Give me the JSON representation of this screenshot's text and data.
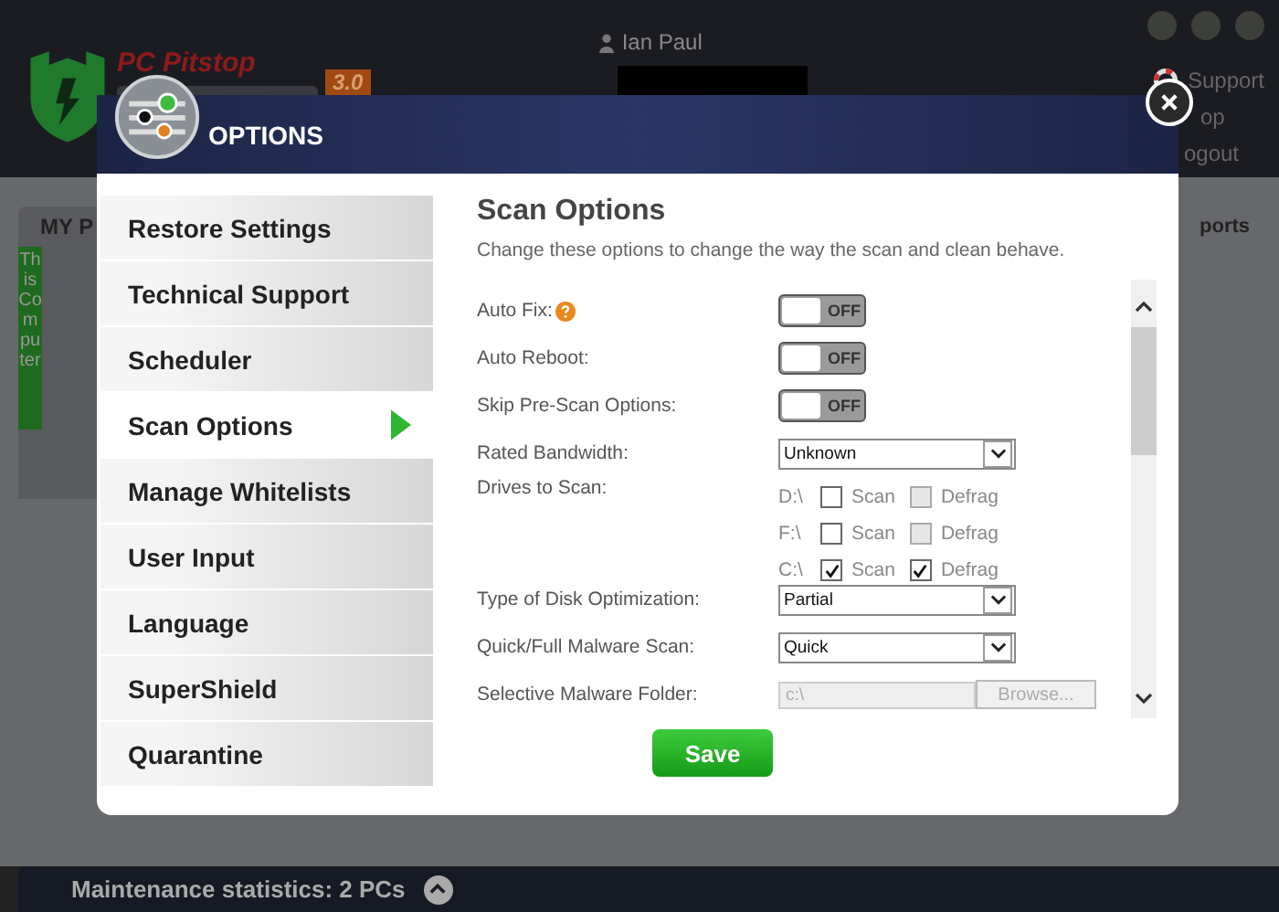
{
  "app": {
    "brand": "PC Pitstop",
    "version": "3.0",
    "user": "Ian Paul",
    "links": [
      "Support",
      "op",
      "ogout"
    ],
    "tab_label": "MY P",
    "side_tag": "This Computer",
    "tab_right": "ports",
    "status_bar": "Maintenance statistics: 2 PCs"
  },
  "dialog": {
    "title": "OPTIONS",
    "menu": [
      {
        "label": "Restore Settings",
        "selected": false
      },
      {
        "label": "Technical Support",
        "selected": false
      },
      {
        "label": "Scheduler",
        "selected": false
      },
      {
        "label": "Scan Options",
        "selected": true
      },
      {
        "label": "Manage Whitelists",
        "selected": false
      },
      {
        "label": "User Input",
        "selected": false
      },
      {
        "label": "Language",
        "selected": false
      },
      {
        "label": "SuperShield",
        "selected": false
      },
      {
        "label": "Quarantine",
        "selected": false
      }
    ],
    "heading": "Scan Options",
    "description": "Change these options to change the way the scan and clean behave.",
    "settings": [
      {
        "kind": "toggle",
        "label": "Auto Fix:",
        "help": true,
        "on": false,
        "state_text": "OFF"
      },
      {
        "kind": "toggle",
        "label": "Auto Reboot:",
        "help": false,
        "on": false,
        "state_text": "OFF"
      },
      {
        "kind": "toggle",
        "label": "Skip Pre-Scan Options:",
        "help": false,
        "on": false,
        "state_text": "OFF"
      },
      {
        "kind": "select",
        "label": "Rated Bandwidth:",
        "value": "Unknown"
      },
      {
        "kind": "drives",
        "label": "Drives to Scan:",
        "drives": [
          {
            "name": "D:\\",
            "scan": {
              "label": "Scan",
              "checked": false,
              "disabled": false
            },
            "defrag": {
              "label": "Defrag",
              "checked": false,
              "disabled": true
            }
          },
          {
            "name": "F:\\",
            "scan": {
              "label": "Scan",
              "checked": false,
              "disabled": false
            },
            "defrag": {
              "label": "Defrag",
              "checked": false,
              "disabled": true
            }
          },
          {
            "name": "C:\\",
            "scan": {
              "label": "Scan",
              "checked": true,
              "disabled": false
            },
            "defrag": {
              "label": "Defrag",
              "checked": true,
              "disabled": false
            }
          }
        ]
      },
      {
        "kind": "select",
        "label": "Type of Disk Optimization:",
        "value": "Partial"
      },
      {
        "kind": "select",
        "label": "Quick/Full Malware Scan:",
        "value": "Quick"
      },
      {
        "kind": "folder",
        "label": "Selective Malware Folder:",
        "value": "c:\\",
        "button": "Browse...",
        "disabled": true
      }
    ],
    "save": "Save"
  }
}
